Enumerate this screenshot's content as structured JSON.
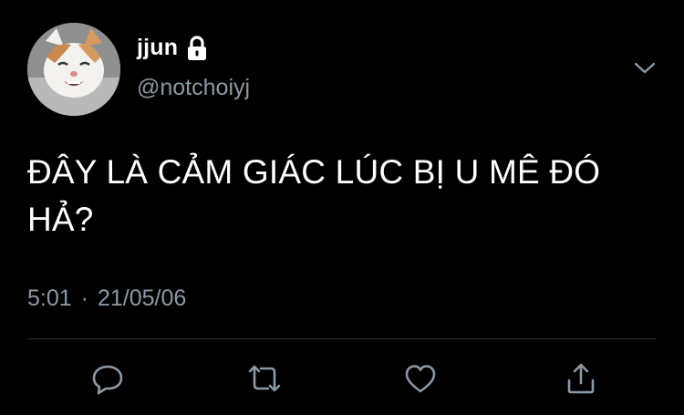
{
  "user": {
    "display_name": "jjun",
    "handle": "@notchoiyj",
    "protected_icon": "lock-icon",
    "avatar_icon": "cat-avatar"
  },
  "tweet": {
    "text_line1": "ĐÂY LÀ CẢM GIÁC LÚC BỊ U MÊ ĐÓ",
    "text_line2": "HẢ?",
    "time": "5:01",
    "separator": "·",
    "date": "21/05/06"
  },
  "actions": [
    {
      "icon": "reply-icon"
    },
    {
      "icon": "retweet-icon"
    },
    {
      "icon": "like-icon"
    },
    {
      "icon": "share-icon"
    }
  ],
  "menu_icon": "chevron-down-icon",
  "colors": {
    "background": "#000000",
    "text": "#ffffff",
    "secondary": "#8b98a5",
    "divider": "#2f3336"
  }
}
